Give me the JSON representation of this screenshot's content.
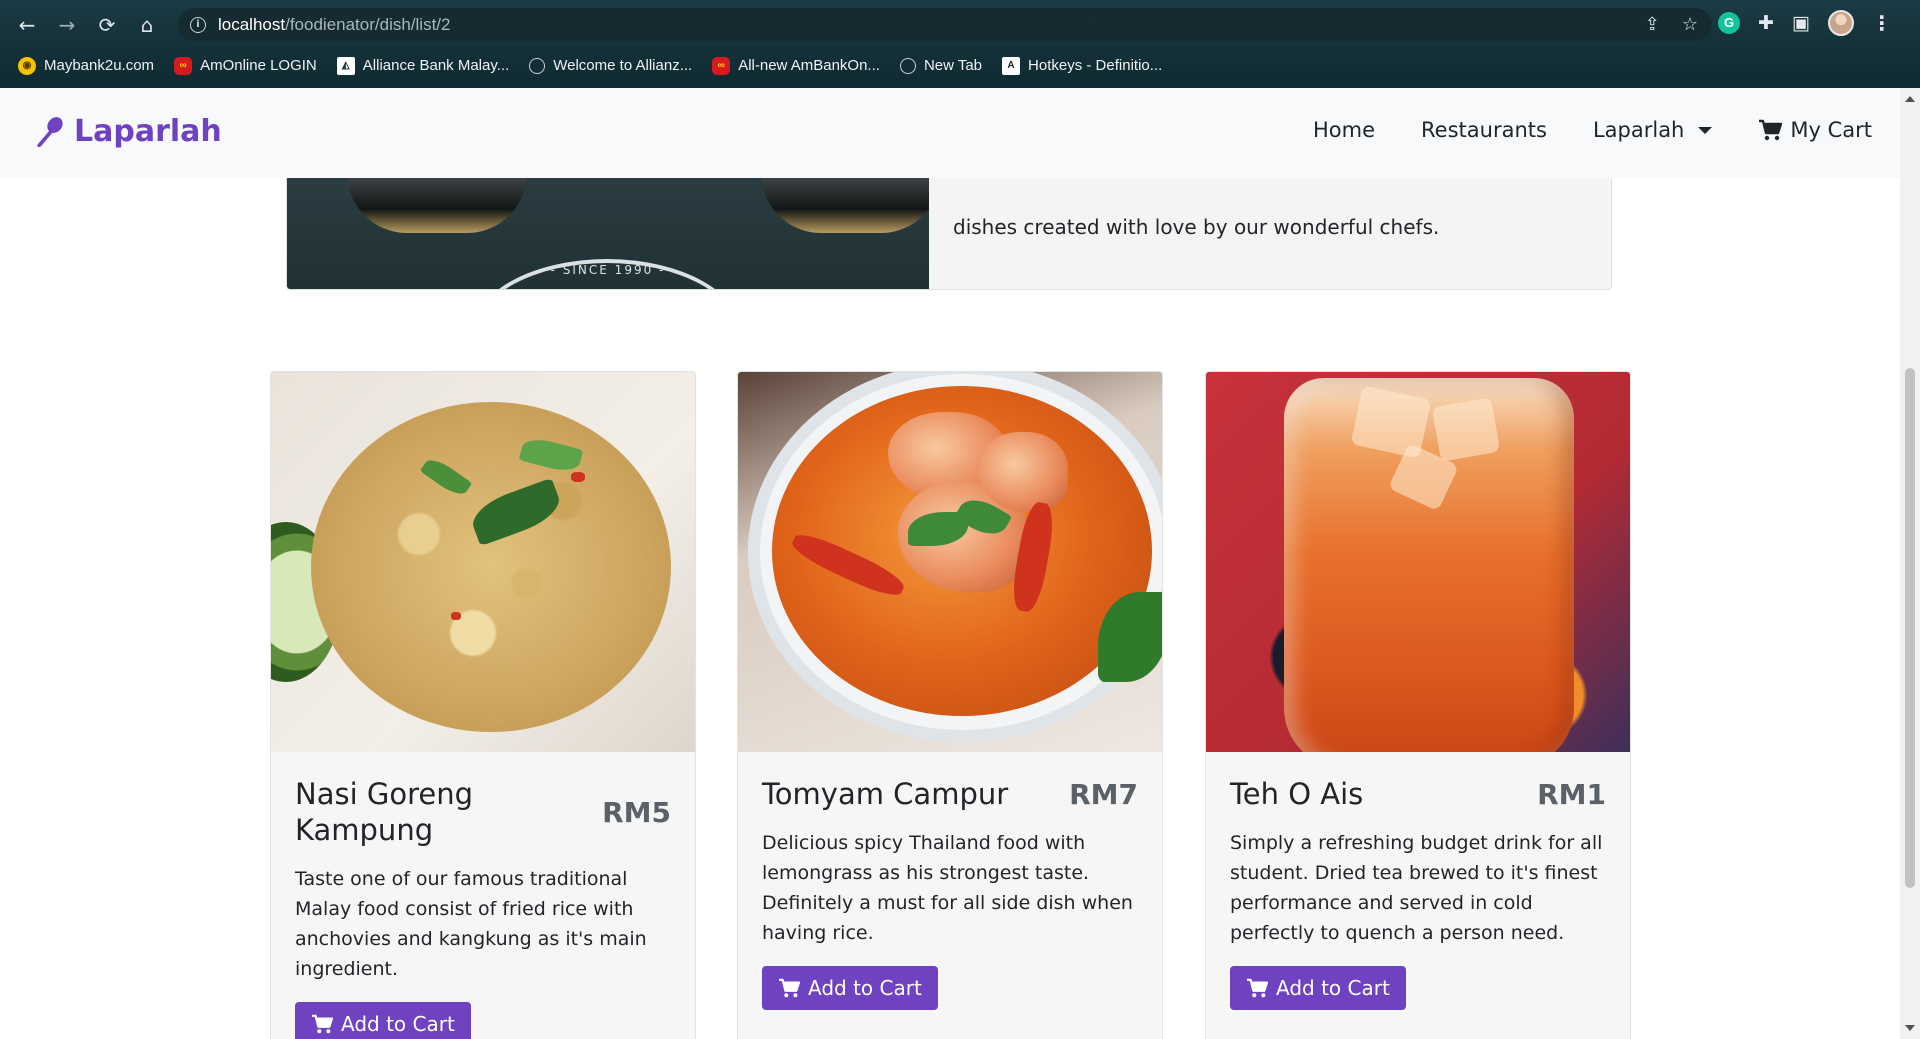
{
  "browser": {
    "url_host": "localhost",
    "url_path": "/foodienator/dish/list/2",
    "nav": {
      "back": "←",
      "forward": "→",
      "reload": "⟳",
      "home": "⌂"
    },
    "omnibox_actions": [
      "share-icon",
      "star-icon"
    ],
    "extensions": [
      "grammarly-icon",
      "puzzle-icon",
      "sidebar-icon",
      "profile-avatar",
      "kebab-menu-icon"
    ],
    "grammarly_letter": "G",
    "bookmarks": [
      {
        "label": "Maybank2u.com",
        "icon": "maybank-icon"
      },
      {
        "label": "AmOnline LOGIN",
        "icon": "amonline-icon"
      },
      {
        "label": "Alliance Bank Malay...",
        "icon": "alliance-icon"
      },
      {
        "label": "Welcome to Allianz...",
        "icon": "globe-icon"
      },
      {
        "label": "All-new AmBankOn...",
        "icon": "ambank-icon"
      },
      {
        "label": "New Tab",
        "icon": "globe-icon"
      },
      {
        "label": "Hotkeys - Definitio...",
        "icon": "hotkeys-icon"
      }
    ]
  },
  "site": {
    "brand": "Laparlah",
    "brand_icon": "spoon-icon",
    "nav": {
      "home": "Home",
      "restaurants": "Restaurants",
      "laparlah": "Laparlah",
      "cart": "My Cart"
    },
    "accent": "#6f42c1"
  },
  "hero": {
    "image_caption": "- SINCE 1990 -",
    "text": "dishes created with love by our wonderful chefs."
  },
  "dishes": [
    {
      "name": "Nasi Goreng Kampung",
      "price": "RM5",
      "description": "Taste one of our famous traditional Malay food consist of fried rice with anchovies and kangkung as it's main ingredient.",
      "button": "Add to Cart"
    },
    {
      "name": "Tomyam Campur",
      "price": "RM7",
      "description": "Delicious spicy Thailand food with lemongrass as his strongest taste. Definitely a must for all side dish when having rice.",
      "button": "Add to Cart"
    },
    {
      "name": "Teh O Ais",
      "price": "RM1",
      "description": "Simply a refreshing budget drink for all student. Dried tea brewed to it's finest performance and served in cold perfectly to quench a person need.",
      "button": "Add to Cart"
    }
  ]
}
